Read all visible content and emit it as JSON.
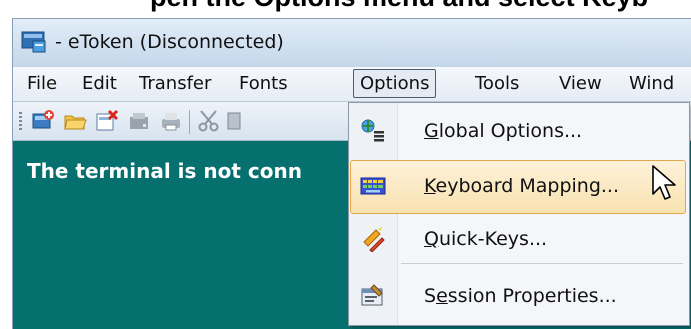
{
  "heading_fragment": "pen the Options menu and select Keyb",
  "window": {
    "title": "- eToken (Disconnected)"
  },
  "menubar": {
    "items": [
      "File",
      "Edit",
      "Transfer",
      "Fonts",
      "Options",
      "Tools",
      "View",
      "Wind"
    ],
    "open_item": "Options"
  },
  "terminal": {
    "message": "The terminal is not conn"
  },
  "options_menu": {
    "items": [
      {
        "label": "Global Options...",
        "underline": "G",
        "rest": "lobal Options...",
        "icon": "global-options-icon"
      },
      {
        "label": "Keyboard Mapping...",
        "underline": "K",
        "rest": "eyboard Mapping...",
        "icon": "keyboard-icon",
        "highlighted": true
      },
      {
        "label": "Quick-Keys...",
        "underline": "Q",
        "rest": "uick-Keys...",
        "icon": "quick-keys-icon"
      },
      {
        "label": "Session Properties...",
        "pre": "S",
        "underline": "e",
        "rest": "ssion Properties...",
        "icon": "session-properties-icon"
      }
    ]
  },
  "colors": {
    "terminal_bg": "#06706e",
    "highlight_bg": "#f8e2b0",
    "highlight_border": "#e0a84a"
  }
}
